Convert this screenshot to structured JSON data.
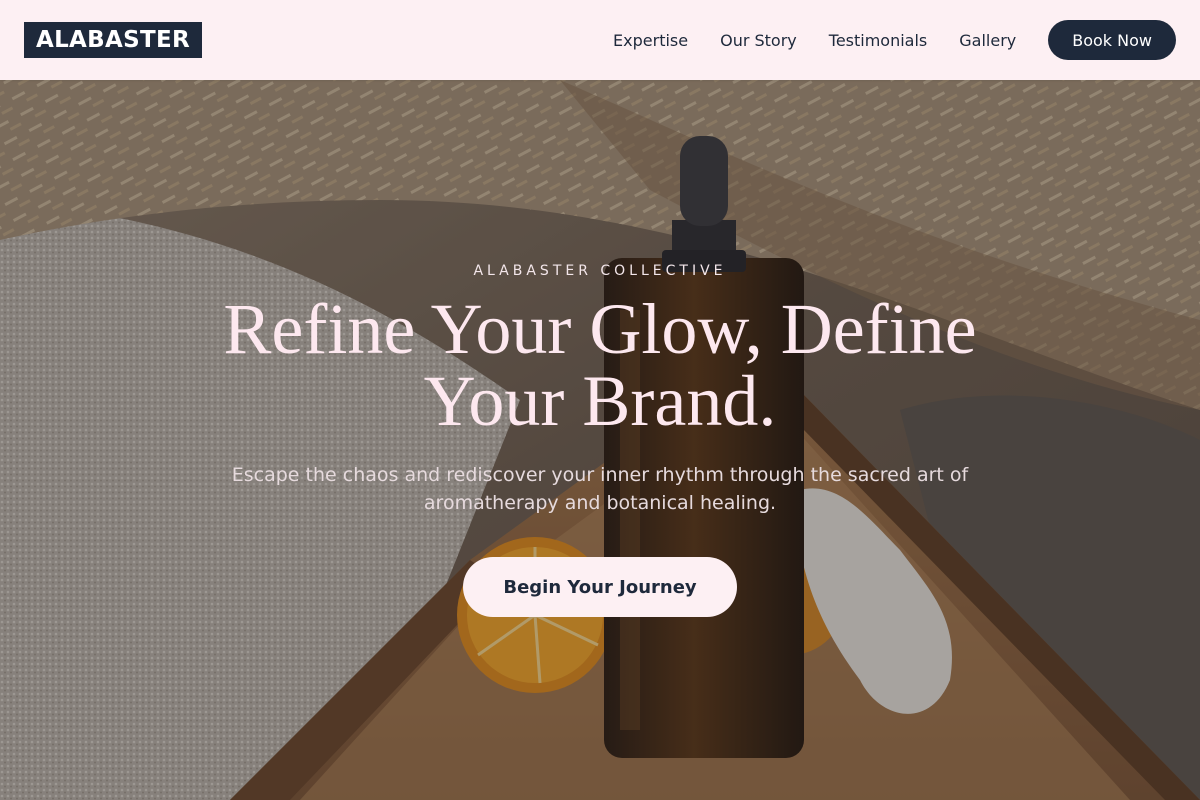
{
  "header": {
    "logo": "ALABASTER",
    "nav": [
      {
        "label": "Expertise"
      },
      {
        "label": "Our Story"
      },
      {
        "label": "Testimonials"
      },
      {
        "label": "Gallery"
      }
    ],
    "book_label": "Book Now"
  },
  "hero": {
    "eyebrow": "ALABASTER COLLECTIVE",
    "headline": "Refine Your Glow, Define Your Brand.",
    "subtext": "Escape the chaos and rediscover your inner rhythm through the sacred art of aromatherapy and botanical healing.",
    "cta_label": "Begin Your Journey",
    "image": "essential-oil-bottle-on-wooden-tray-with-orange-slice-and-dried-grass"
  },
  "colors": {
    "header_bg": "#fdf0f3",
    "navy": "#1e293b",
    "headline": "#fde8ef"
  }
}
